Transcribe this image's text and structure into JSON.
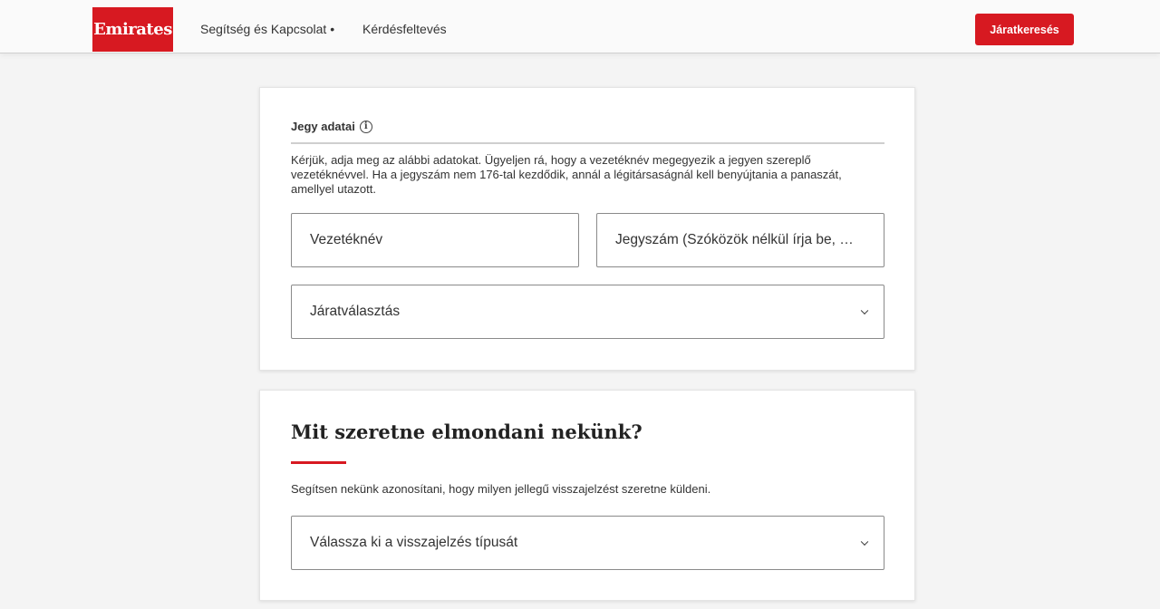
{
  "header": {
    "logo_text": "Emirates",
    "nav": {
      "help_label": "Segítség és Kapcsolat •",
      "ask_label": "Kérdésfeltevés"
    },
    "search_button_label": "Járatkeresés"
  },
  "ticket_section": {
    "title": "Jegy adatai",
    "info_icon": "ⓘ",
    "description": "Kérjük, adja meg az alábbi adatokat. Ügyeljen rá, hogy a vezetéknév megegyezik a jegyen szereplő vezetéknévvel. Ha a jegyszám nem 176-tal kezdődik, annál a légitársaságnál kell benyújtania a panaszát, amellyel utazott.",
    "surname_placeholder": "Vezetéknév",
    "ticket_placeholder": "Jegyszám (Szóközök nélkül írja be, …",
    "flight_select_label": "Járatválasztás"
  },
  "feedback_section": {
    "title": "Mit szeretne elmondani nekünk?",
    "description": "Segítsen nekünk azonosítani, hogy milyen jellegű visszajelzést szeretne küldeni.",
    "type_select_label": "Válassza ki a visszajelzés típusát"
  },
  "colors": {
    "brand_red": "#d71921",
    "background": "#f4f4f4"
  }
}
